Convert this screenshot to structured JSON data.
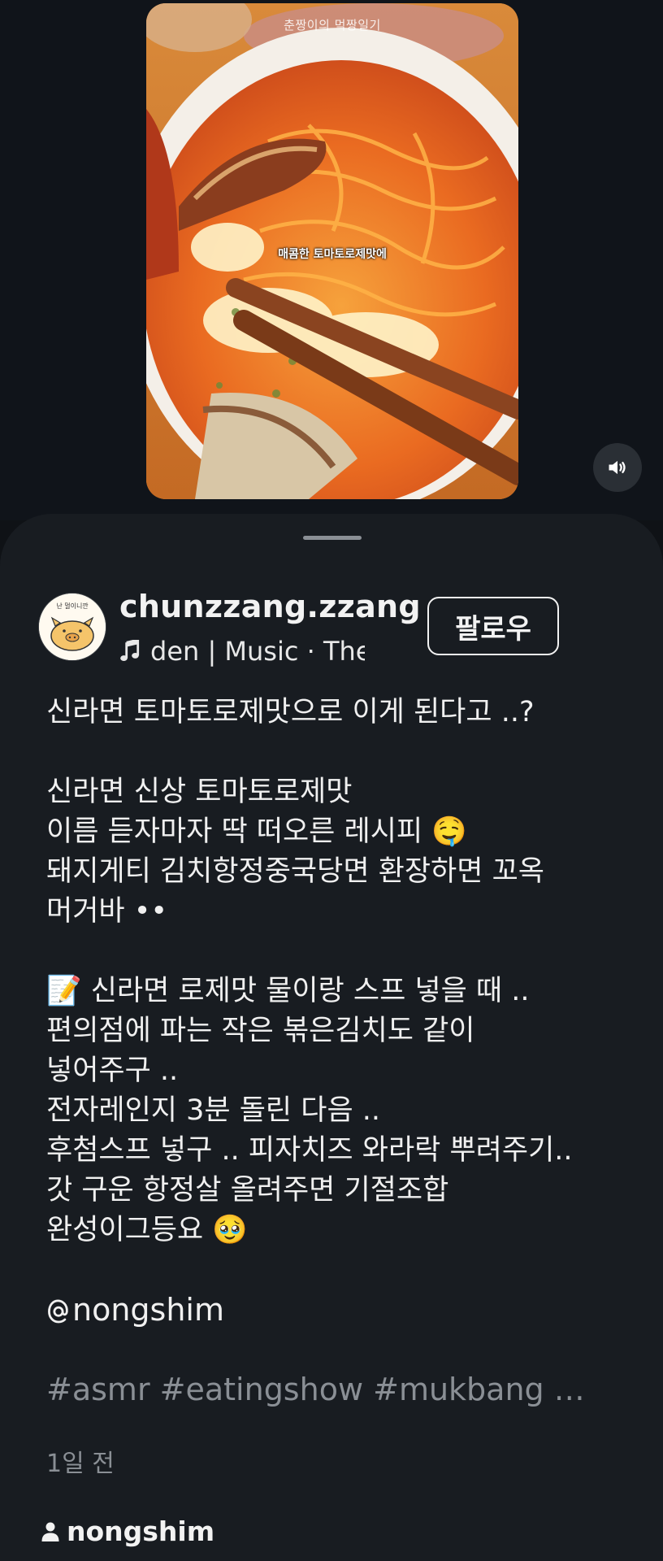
{
  "video": {
    "watermark": "춘짱이의 먹짱일기",
    "caption": "매콤한 토마토로제맛에",
    "mute_icon": "speaker-volume-icon"
  },
  "post": {
    "username": "chunzzang.zzang",
    "music_text": "den | Music · The",
    "music_icon": "music-note-icon",
    "follow_label": "팔로우",
    "avatar_icon": "cartoon-pig-avatar",
    "avatar_text": "난 멀이니깐",
    "caption_lines": [
      "신라면 토마토로제맛으로 이게 된다고 ..?",
      "",
      "신라면 신상 토마토로제맛",
      "이름 듣자마자 딱 떠오른 레시피 🤤",
      "돼지게티 김치항정중국당면 환장하면 꼬옥",
      "머거바 ••",
      "",
      "📝 신라면 로제맛 물이랑 스프 넣을 때 ..",
      "편의점에 파는 작은 볶은김치도 같이",
      "넣어주구 ..",
      "전자레인지 3분 돌린 다음 ..",
      "후첨스프 넣구 .. 피자치즈 와라락 뿌려주기..",
      "갓 구운 항정살 올려주면 기절조합",
      "완성이그등요 🥹",
      ""
    ],
    "mention": "nongshim",
    "hashtags": "#asmr #eatingshow #mukbang …",
    "timestamp": "1일 전",
    "tagged_user": "nongshim"
  },
  "colors": {
    "background": "#0f1216",
    "sheet": "#181c21",
    "text_primary": "#f2f2f2",
    "text_secondary": "#8a8f95"
  }
}
